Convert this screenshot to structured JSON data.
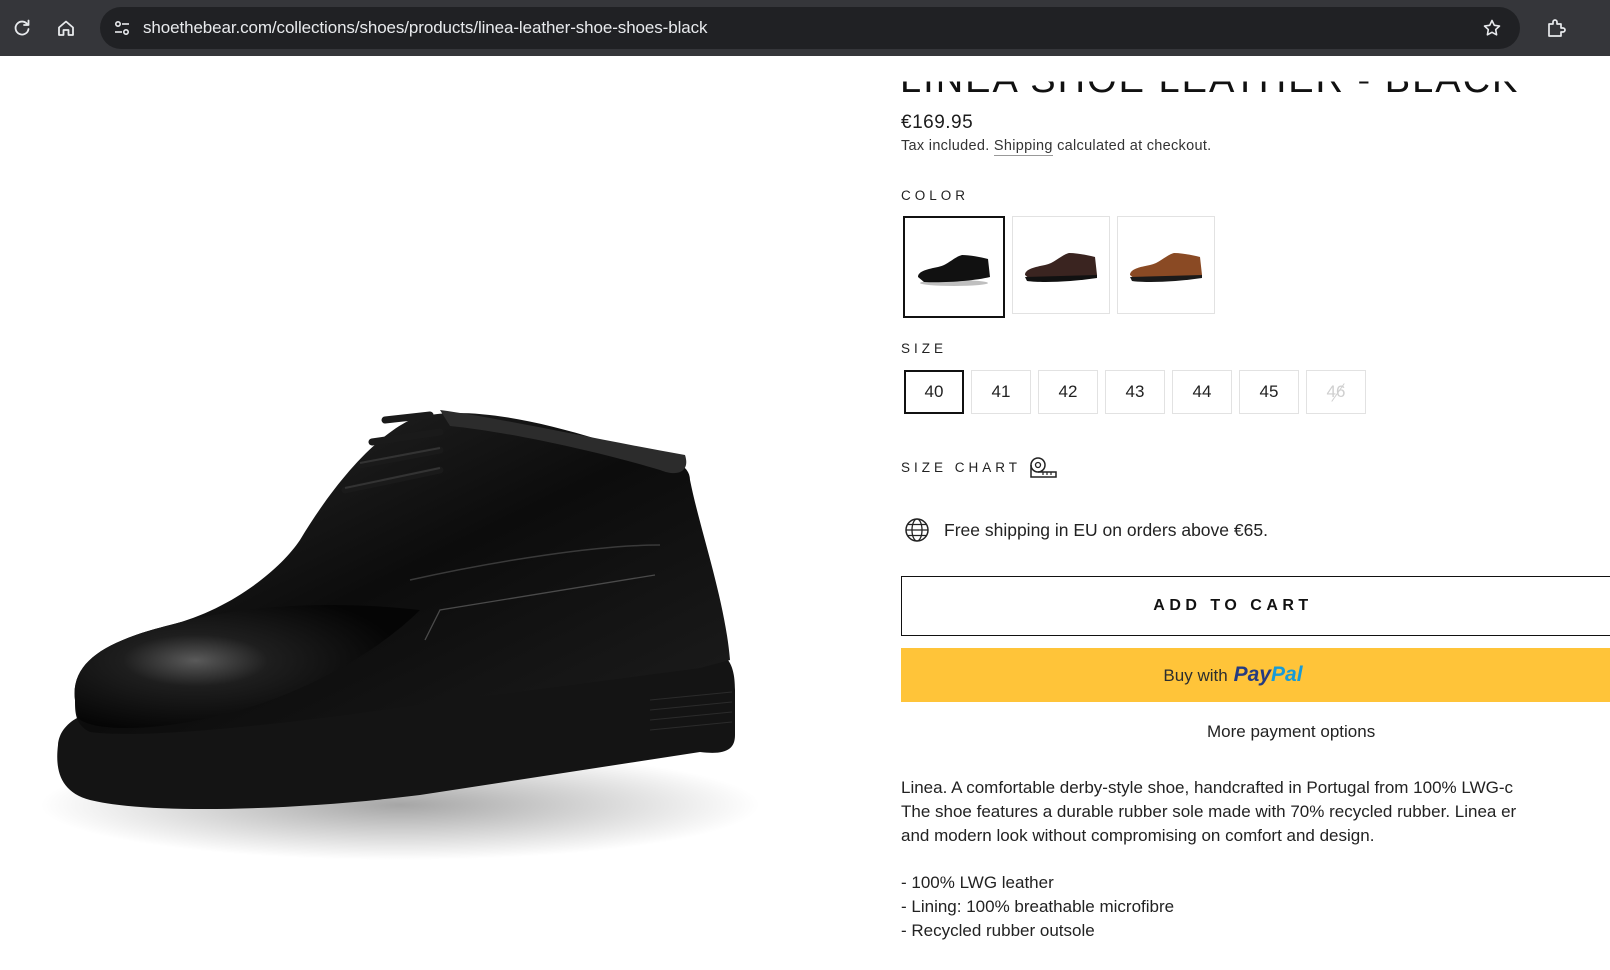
{
  "browser": {
    "url": "shoethebear.com/collections/shoes/products/linea-leather-shoe-shoes-black"
  },
  "product": {
    "title": "LINEA SHOE LEATHER - BLACK",
    "price": "€169.95",
    "tax_prefix": "Tax included.",
    "shipping_link": "Shipping",
    "tax_suffix": "calculated at checkout.",
    "color_label": "COLOR",
    "colors": [
      {
        "name": "black",
        "hex": "#111111",
        "selected": true
      },
      {
        "name": "dark-brown",
        "hex": "#3a2420",
        "selected": false
      },
      {
        "name": "cognac",
        "hex": "#8a4a24",
        "selected": false
      }
    ],
    "size_label": "SIZE",
    "sizes": [
      {
        "label": "40",
        "selected": true,
        "available": true
      },
      {
        "label": "41",
        "selected": false,
        "available": true
      },
      {
        "label": "42",
        "selected": false,
        "available": true
      },
      {
        "label": "43",
        "selected": false,
        "available": true
      },
      {
        "label": "44",
        "selected": false,
        "available": true
      },
      {
        "label": "45",
        "selected": false,
        "available": true
      },
      {
        "label": "46",
        "selected": false,
        "available": false
      }
    ],
    "size_chart_label": "SIZE CHART",
    "free_shipping": "Free shipping in EU on orders above €65.",
    "add_to_cart": "ADD TO CART",
    "paypal_prefix": "Buy with",
    "paypal_pay": "Pay",
    "paypal_pal": "Pal",
    "more_payment": "More payment options",
    "description": [
      "Linea. A comfortable derby-style shoe, handcrafted in Portugal from 100% LWG-c",
      "The shoe features a durable rubber sole made with 70% recycled rubber. Linea er",
      "and modern look without compromising on comfort and design."
    ],
    "features": [
      "- 100% LWG leather",
      "- Lining: 100% breathable microfibre",
      "- Recycled rubber outsole"
    ]
  },
  "colors": {
    "chrome": "#35363a",
    "omnibox": "#202124",
    "paypal_button": "#ffc439"
  }
}
